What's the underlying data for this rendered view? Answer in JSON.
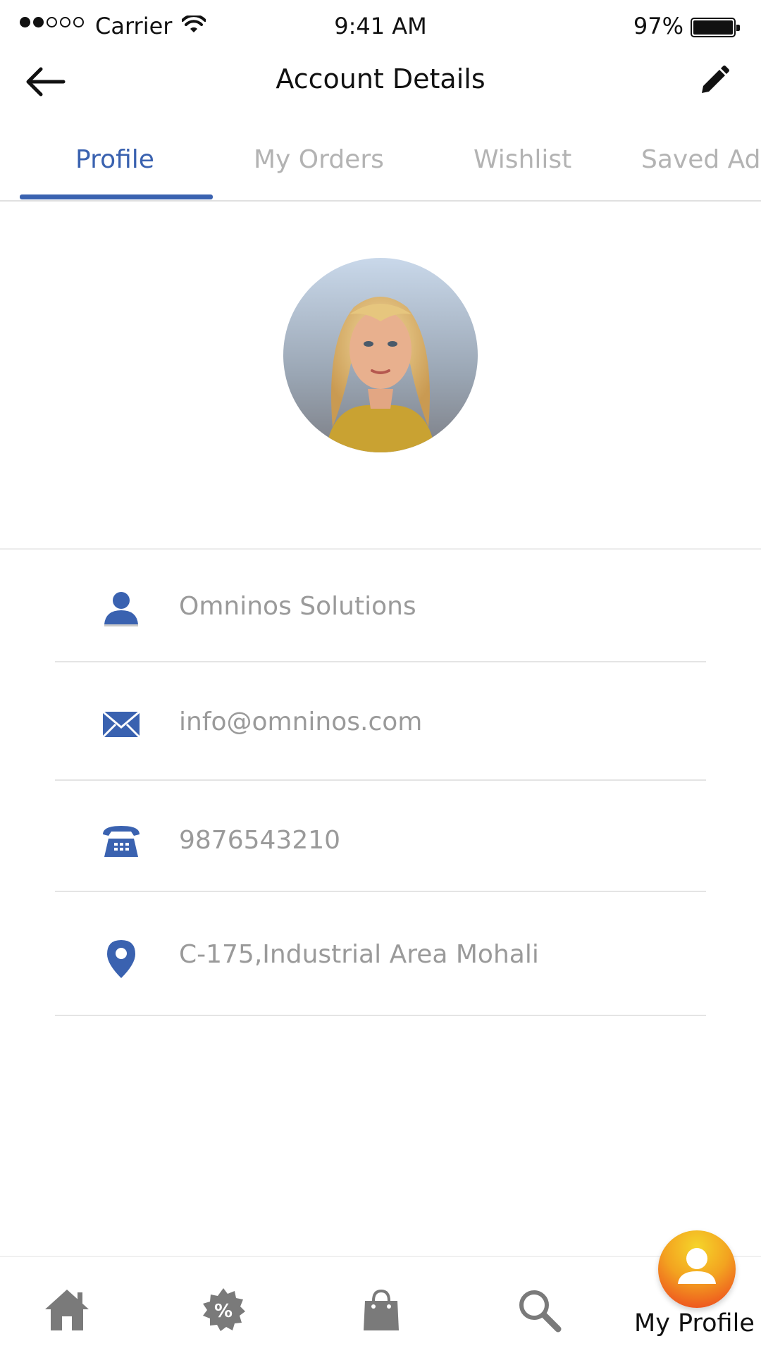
{
  "status_bar": {
    "carrier": "Carrier",
    "time": "9:41 AM",
    "battery_pct": "97%",
    "signal_bars_filled": 2,
    "signal_bars_total": 5
  },
  "header": {
    "title": "Account Details",
    "back_icon": "arrow-left-icon",
    "edit_icon": "pencil-icon"
  },
  "tabs": [
    {
      "label": "Profile",
      "active": true
    },
    {
      "label": "My Orders",
      "active": false
    },
    {
      "label": "Wishlist",
      "active": false
    },
    {
      "label": "Saved Ad",
      "active": false
    }
  ],
  "profile": {
    "avatar_icon": "user-photo",
    "name": "Omninos Solutions",
    "email": "info@omninos.com",
    "phone": "9876543210",
    "address": "C-175,Industrial Area Mohali"
  },
  "bottom_nav": {
    "items": [
      {
        "icon": "home-icon"
      },
      {
        "icon": "offers-percent-icon"
      },
      {
        "icon": "shopping-bag-icon"
      },
      {
        "icon": "search-icon"
      }
    ],
    "active_label": "My Profile"
  },
  "colors": {
    "accent": "#3a62b0",
    "muted_text": "#9a9a9a",
    "inactive_tab": "#b3b3b3",
    "fab_gradient_top": "#f5d52a",
    "fab_gradient_bottom": "#ec3b1e"
  }
}
